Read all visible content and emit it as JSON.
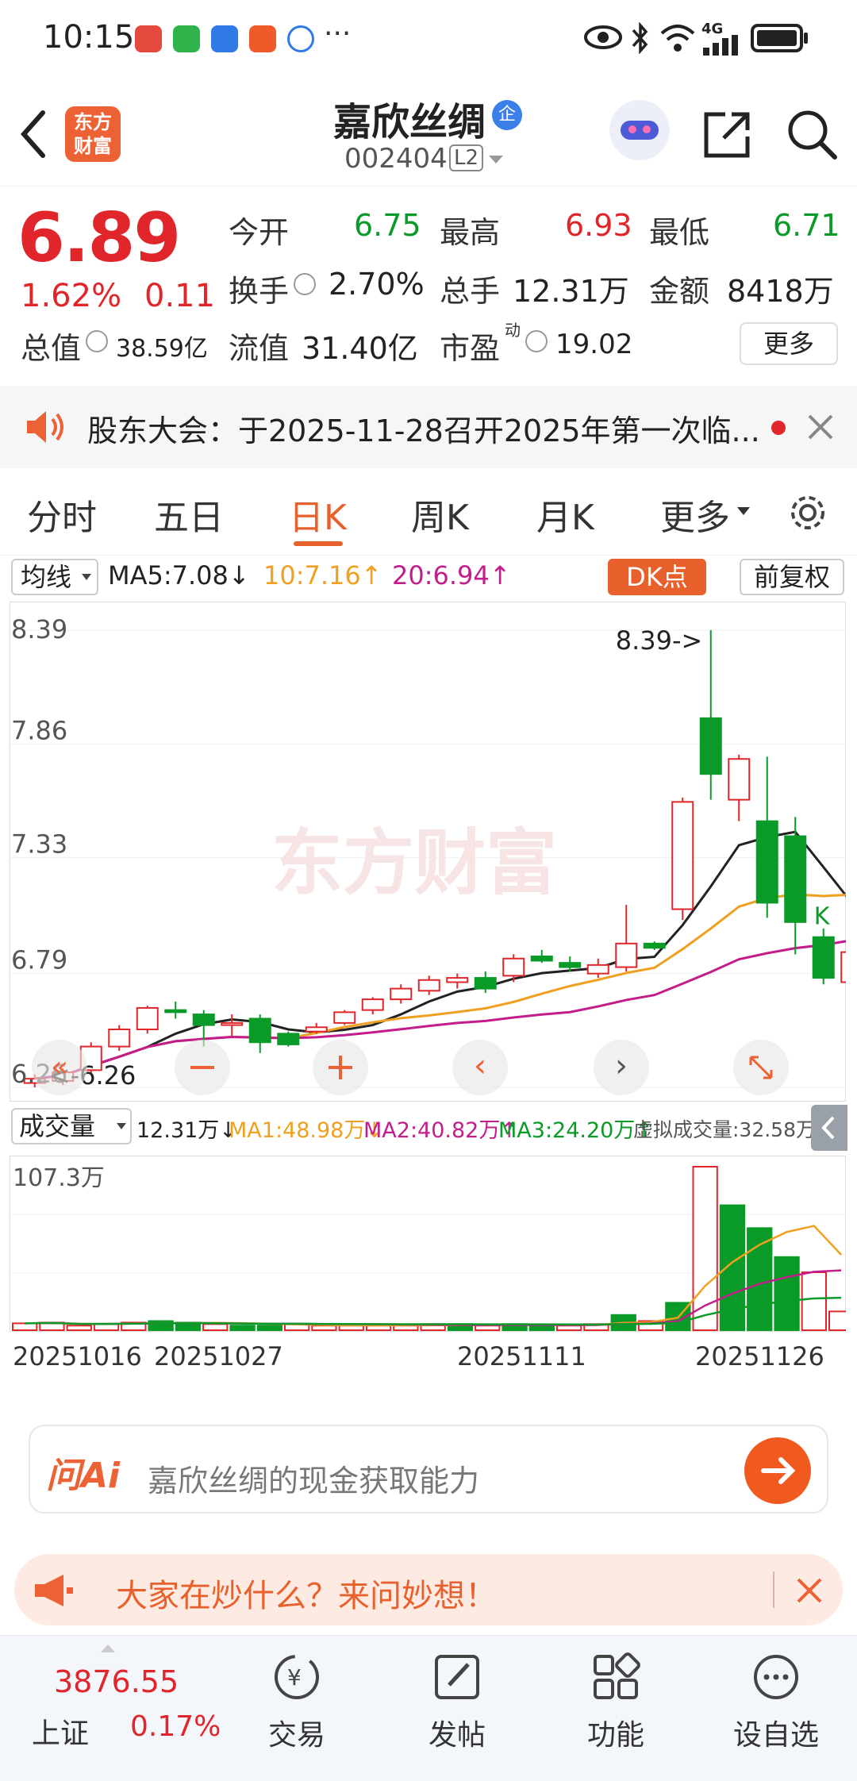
{
  "status_bar": {
    "time": "10:15",
    "dots": "···",
    "network": "4G"
  },
  "header": {
    "stock_name": "嘉欣丝绸",
    "badge": "企",
    "code": "002404",
    "level": "L2",
    "logo_line1": "东方",
    "logo_line2": "财富"
  },
  "quote": {
    "price": "6.89",
    "change_pct": "1.62%",
    "change": "0.11",
    "open_label": "今开",
    "open": "6.75",
    "high_label": "最高",
    "high": "6.93",
    "low_label": "最低",
    "low": "6.71",
    "turnover_label": "换手",
    "turnover": "2.70%",
    "volume_label": "总手",
    "volume": "12.31万",
    "amount_label": "金额",
    "amount": "8418万",
    "mktcap_label": "总值",
    "mktcap": "38.59亿",
    "float_label": "流值",
    "float_cap": "31.40亿",
    "pe_label": "市盈",
    "pe_sup": "动",
    "pe": "19.02",
    "more_button": "更多"
  },
  "notice": {
    "text": "股东大会：于2025-11-28召开2025年第一次临..."
  },
  "tabs": [
    "分时",
    "五日",
    "日K",
    "周K",
    "月K",
    "更多"
  ],
  "active_tab": "日K",
  "kline": {
    "ma_select": "均线",
    "ma5": "MA5:7.08↓",
    "ma10": "10:7.16↑",
    "ma20": "20:6.94↑",
    "dk_button": "DK点",
    "adjust_button": "前复权",
    "y_labels": [
      "8.39",
      "7.86",
      "7.33",
      "6.79",
      "6.26"
    ],
    "max_annotation": "8.39->",
    "min_annotation": "<-6.26",
    "k_marker": "K",
    "watermark": "东方财富"
  },
  "volume": {
    "select": "成交量",
    "value": "12.31万↓",
    "ma1": "MA1:48.98万↓",
    "ma2": "MA2:40.82万↑",
    "ma3": "MA3:24.20万↑",
    "virtual": "虚拟成交量:32.58万",
    "y_max": "107.3万",
    "dates": [
      "20251016",
      "20251027",
      "20251111",
      "20251126"
    ]
  },
  "ai": {
    "logo": "问Ai",
    "placeholder": "嘉欣丝绸的现金获取能力"
  },
  "promo": {
    "text": "大家在炒什么？来问妙想！"
  },
  "bottom_nav": {
    "index_value": "3876.55",
    "index_name": "上证",
    "index_change": "0.17%",
    "items": [
      "交易",
      "发帖",
      "功能",
      "设自选"
    ]
  },
  "colors": {
    "up": "#e0262b",
    "down": "#0a9a28",
    "accent": "#e8602b",
    "ma5": "#222222",
    "ma10": "#f0a020",
    "ma20": "#c21d8b"
  },
  "chart_data": {
    "type": "candlestick",
    "y_range": [
      6.26,
      8.39
    ],
    "candles": [
      {
        "o": 6.28,
        "c": 6.3,
        "h": 6.32,
        "l": 6.26
      },
      {
        "o": 6.29,
        "c": 6.33,
        "h": 6.35,
        "l": 6.27
      },
      {
        "o": 6.34,
        "c": 6.45,
        "h": 6.47,
        "l": 6.32
      },
      {
        "o": 6.45,
        "c": 6.53,
        "h": 6.55,
        "l": 6.43
      },
      {
        "o": 6.53,
        "c": 6.63,
        "h": 6.64,
        "l": 6.51
      },
      {
        "o": 6.62,
        "c": 6.61,
        "h": 6.66,
        "l": 6.58
      },
      {
        "o": 6.6,
        "c": 6.55,
        "h": 6.62,
        "l": 6.45
      },
      {
        "o": 6.55,
        "c": 6.56,
        "h": 6.6,
        "l": 6.5
      },
      {
        "o": 6.58,
        "c": 6.47,
        "h": 6.6,
        "l": 6.42
      },
      {
        "o": 6.51,
        "c": 6.46,
        "h": 6.52,
        "l": 6.45
      },
      {
        "o": 6.52,
        "c": 6.54,
        "h": 6.56,
        "l": 6.51
      },
      {
        "o": 6.56,
        "c": 6.61,
        "h": 6.62,
        "l": 6.55
      },
      {
        "o": 6.62,
        "c": 6.67,
        "h": 6.68,
        "l": 6.6
      },
      {
        "o": 6.67,
        "c": 6.72,
        "h": 6.74,
        "l": 6.65
      },
      {
        "o": 6.71,
        "c": 6.76,
        "h": 6.78,
        "l": 6.69
      },
      {
        "o": 6.75,
        "c": 6.77,
        "h": 6.79,
        "l": 6.72
      },
      {
        "o": 6.77,
        "c": 6.72,
        "h": 6.8,
        "l": 6.7
      },
      {
        "o": 6.78,
        "c": 6.86,
        "h": 6.88,
        "l": 6.75
      },
      {
        "o": 6.87,
        "c": 6.85,
        "h": 6.9,
        "l": 6.84
      },
      {
        "o": 6.84,
        "c": 6.82,
        "h": 6.87,
        "l": 6.8
      },
      {
        "o": 6.79,
        "c": 6.83,
        "h": 6.86,
        "l": 6.77
      },
      {
        "o": 6.82,
        "c": 6.93,
        "h": 7.11,
        "l": 6.8
      },
      {
        "o": 6.93,
        "c": 6.91,
        "h": 6.94,
        "l": 6.9
      },
      {
        "o": 7.09,
        "c": 7.59,
        "h": 7.61,
        "l": 7.04
      },
      {
        "o": 7.98,
        "c": 7.72,
        "h": 8.39,
        "l": 7.6
      },
      {
        "o": 7.6,
        "c": 7.79,
        "h": 7.81,
        "l": 7.5
      },
      {
        "o": 7.5,
        "c": 7.12,
        "h": 7.8,
        "l": 7.05
      },
      {
        "o": 7.43,
        "c": 7.03,
        "h": 7.52,
        "l": 6.88
      },
      {
        "o": 6.96,
        "c": 6.77,
        "h": 7.0,
        "l": 6.74
      },
      {
        "o": 6.75,
        "c": 6.89,
        "h": 6.93,
        "l": 6.71
      }
    ],
    "volumes": [
      4.5,
      5,
      3,
      4,
      5,
      6,
      5,
      4,
      3,
      3,
      4,
      3,
      3,
      3,
      3,
      4,
      4,
      3,
      4,
      3,
      3,
      4,
      10,
      6,
      18,
      107.3,
      82,
      67,
      48,
      38,
      12.31
    ]
  }
}
